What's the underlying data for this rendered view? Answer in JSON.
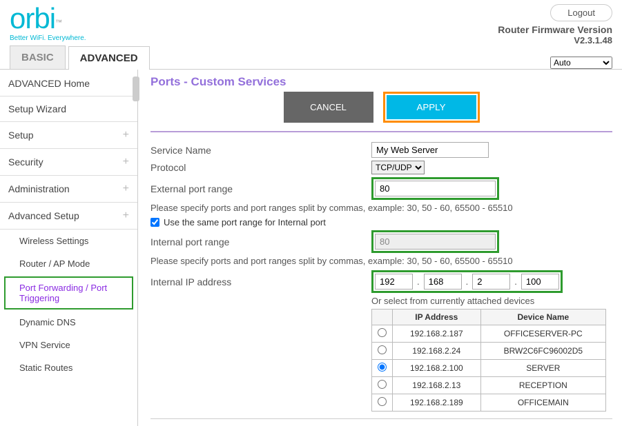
{
  "header": {
    "logo_main": "orbi",
    "logo_tm": "™",
    "logo_tag": "Better WiFi. Everywhere.",
    "logout": "Logout",
    "fw_label": "Router Firmware Version",
    "fw_version": "V2.3.1.48",
    "lang_options": [
      "Auto"
    ],
    "lang_selected": "Auto"
  },
  "tabs": {
    "basic": "BASIC",
    "advanced": "ADVANCED"
  },
  "sidebar": {
    "items": [
      {
        "label": "ADVANCED Home",
        "expandable": false
      },
      {
        "label": "Setup Wizard",
        "expandable": false
      },
      {
        "label": "Setup",
        "expandable": true
      },
      {
        "label": "Security",
        "expandable": true
      },
      {
        "label": "Administration",
        "expandable": true
      },
      {
        "label": "Advanced Setup",
        "expandable": true
      }
    ],
    "subitems": [
      {
        "label": "Wireless Settings",
        "active": false
      },
      {
        "label": "Router / AP Mode",
        "active": false
      },
      {
        "label": "Port Forwarding / Port Triggering",
        "active": true
      },
      {
        "label": "Dynamic DNS",
        "active": false
      },
      {
        "label": "VPN Service",
        "active": false
      },
      {
        "label": "Static Routes",
        "active": false
      }
    ]
  },
  "content": {
    "title": "Ports - Custom Services",
    "cancel": "CANCEL",
    "apply": "APPLY",
    "labels": {
      "service_name": "Service Name",
      "protocol": "Protocol",
      "ext_port": "External port range",
      "int_port": "Internal port range",
      "int_ip": "Internal IP address",
      "same_port": "Use the same port range for Internal port",
      "or_select": "Or select from currently attached devices"
    },
    "values": {
      "service_name": "My Web Server",
      "protocol_options": [
        "TCP/UDP"
      ],
      "protocol_selected": "TCP/UDP",
      "ext_port": "80",
      "int_port": "80",
      "ip": [
        "192",
        "168",
        "2",
        "100"
      ],
      "same_port_checked": true
    },
    "hint": "Please specify ports and port ranges split by commas, example: 30, 50 - 60, 65500 - 65510",
    "dev_table": {
      "headers": [
        "IP Address",
        "Device Name"
      ],
      "rows": [
        {
          "ip": "192.168.2.187",
          "name": "OFFICESERVER-PC",
          "selected": false
        },
        {
          "ip": "192.168.2.24",
          "name": "BRW2C6FC96002D5",
          "selected": false
        },
        {
          "ip": "192.168.2.100",
          "name": "SERVER",
          "selected": true
        },
        {
          "ip": "192.168.2.13",
          "name": "RECEPTION",
          "selected": false
        },
        {
          "ip": "192.168.2.189",
          "name": "OFFICEMAIN",
          "selected": false
        }
      ]
    }
  }
}
